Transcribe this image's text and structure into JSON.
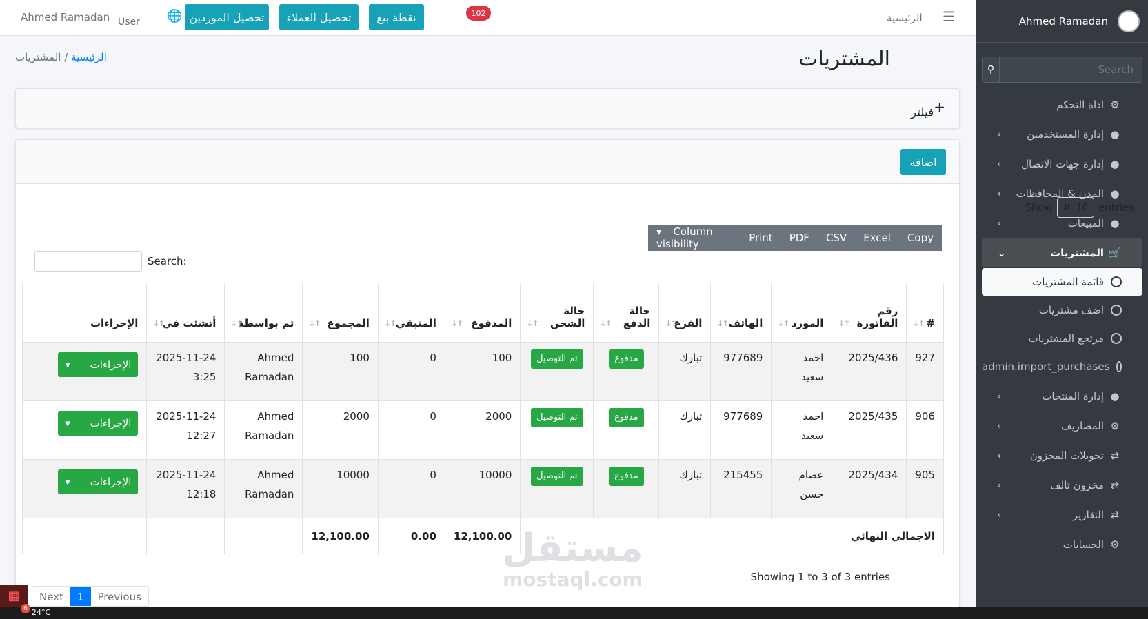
{
  "sidebar": {
    "user_name": "Ahmed Ramadan",
    "search_placeholder": "Search",
    "items": [
      {
        "label": "اداة التحكم",
        "icon": "dashboard-icon",
        "chevron": false
      },
      {
        "label": "إدارة المستخدمين",
        "icon": "user-icon",
        "chevron": true
      },
      {
        "label": "إدارة جهات الاتصال",
        "icon": "user-icon",
        "chevron": true
      },
      {
        "label": "المدن & المحافظات",
        "icon": "user-icon",
        "chevron": true
      },
      {
        "label": "المبيعات",
        "icon": "user-icon",
        "chevron": true
      },
      {
        "label": "المشتريات",
        "icon": "cart-icon",
        "chevron": true,
        "open": true
      }
    ],
    "subitems": [
      {
        "label": "قائمة المشتريات",
        "active": true
      },
      {
        "label": "اضف مشتريات"
      },
      {
        "label": "مرتجع المشتريات"
      },
      {
        "label": "admin.import_purchases"
      }
    ],
    "items2": [
      {
        "label": "إدارة المنتجات",
        "icon": "user-icon"
      },
      {
        "label": "المصاريف",
        "icon": "dashboard-icon"
      },
      {
        "label": "تحويلات المخزون",
        "icon": "exchange-icon"
      },
      {
        "label": "مخزون تالف",
        "icon": "exchange-icon"
      },
      {
        "label": "التقارير",
        "icon": "exchange-icon"
      },
      {
        "label": "الحسابات",
        "icon": "dashboard-icon"
      }
    ]
  },
  "topnav": {
    "user_name": "Ahmed Ramadan",
    "user_img_alt": "User",
    "btn_suppliers": "تحصيل الموردين",
    "btn_customers": "تحصيل العملاء",
    "btn_pos": "نقطة بيع",
    "badge": "102",
    "home": "الرئيسية"
  },
  "page": {
    "title": "المشتريات",
    "breadcrumb_home": "الرئيسية",
    "breadcrumb_current": "المشتريات",
    "filter_label": "فيلتر",
    "add_label": "اضافه"
  },
  "table_controls": {
    "show": "Show",
    "entries_value": "10",
    "entries": "entries",
    "search_label": "Search:",
    "buttons": [
      "Copy",
      "Excel",
      "CSV",
      "PDF",
      "Print",
      "Column visibility"
    ]
  },
  "table": {
    "headers": [
      "#",
      "رقم الفاتورة",
      "المورد",
      "الهاتف",
      "الفرع",
      "حالة الدفع",
      "حالة الشحن",
      "المدفوع",
      "المتبقي",
      "المجموع",
      "تم بواسطة",
      "أنشئت في",
      "الإجراءات"
    ],
    "rows": [
      {
        "id": "927",
        "invoice": "2025/436",
        "supplier": "احمد سعيد",
        "phone": "977689",
        "branch": "تبارك",
        "pay": "مدفوع",
        "ship": "تم التوصيل",
        "paid": "100",
        "remain": "0",
        "total": "100",
        "by": "Ahmed Ramadan",
        "created": "2025-11-24 3:25",
        "action": "الإجراءات"
      },
      {
        "id": "906",
        "invoice": "2025/435",
        "supplier": "احمد سعيد",
        "phone": "977689",
        "branch": "تبارك",
        "pay": "مدفوع",
        "ship": "تم التوصيل",
        "paid": "2000",
        "remain": "0",
        "total": "2000",
        "by": "Ahmed Ramadan",
        "created": "2025-11-24 12:27",
        "action": "الإجراءات"
      },
      {
        "id": "905",
        "invoice": "2025/434",
        "supplier": "عصام حسن",
        "phone": "215455",
        "branch": "تبارك",
        "pay": "مدفوع",
        "ship": "تم التوصيل",
        "paid": "10000",
        "remain": "0",
        "total": "10000",
        "by": "Ahmed Ramadan",
        "created": "2025-11-24 12:18",
        "action": "الإجراءات"
      }
    ],
    "footer": {
      "label": "الاجمالي النهائي",
      "paid": "12,100.00",
      "remain": "0.00",
      "total": "12,100.00"
    }
  },
  "pagination": {
    "showing": "Showing 1 to 3 of 3 entries",
    "previous": "Previous",
    "current": "1",
    "next": "Next"
  },
  "watermark": {
    "line1": "مستقل",
    "line2": "mostaql.com"
  },
  "taskbar": {
    "temp": "24°C",
    "notif": "6"
  },
  "colors": {
    "accent": "#17a2b8",
    "sidebar": "#343a40",
    "success": "#28a745",
    "danger": "#dc3545"
  }
}
